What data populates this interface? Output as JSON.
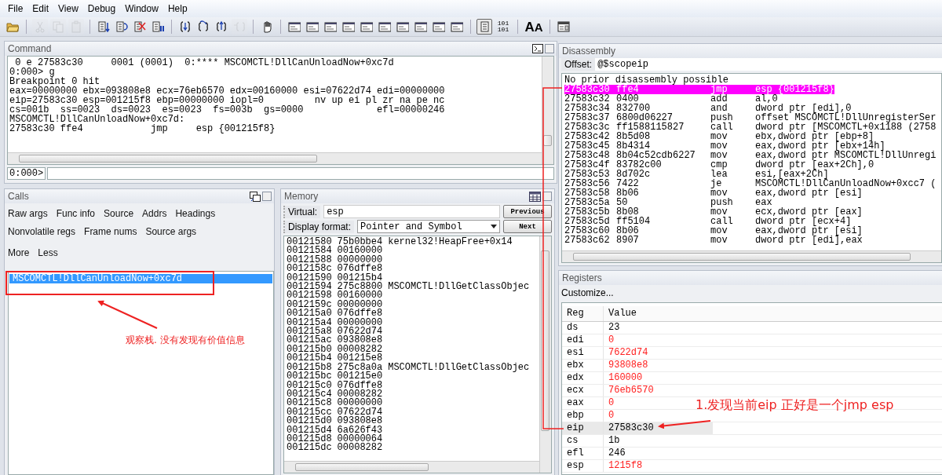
{
  "menu": [
    "File",
    "Edit",
    "View",
    "Debug",
    "Window",
    "Help"
  ],
  "toolbar": [
    {
      "kind": "open",
      "disabled": false
    },
    {
      "kind": "sep"
    },
    {
      "kind": "cut",
      "disabled": true
    },
    {
      "kind": "copy",
      "disabled": true
    },
    {
      "kind": "paste",
      "disabled": true
    },
    {
      "kind": "sep"
    },
    {
      "kind": "go",
      "disabled": false
    },
    {
      "kind": "restart",
      "disabled": false
    },
    {
      "kind": "stop",
      "disabled": false
    },
    {
      "kind": "break",
      "disabled": false
    },
    {
      "kind": "sep"
    },
    {
      "kind": "step-into",
      "disabled": false
    },
    {
      "kind": "step-over",
      "disabled": false
    },
    {
      "kind": "step-out",
      "disabled": false
    },
    {
      "kind": "run-to-cursor",
      "disabled": true
    },
    {
      "kind": "sep"
    },
    {
      "kind": "hand",
      "disabled": false
    },
    {
      "kind": "sep"
    },
    {
      "kind": "window",
      "disabled": false
    },
    {
      "kind": "window",
      "disabled": false
    },
    {
      "kind": "window",
      "disabled": false
    },
    {
      "kind": "window",
      "disabled": false
    },
    {
      "kind": "window",
      "disabled": false
    },
    {
      "kind": "window",
      "disabled": false
    },
    {
      "kind": "window",
      "disabled": false
    },
    {
      "kind": "window",
      "disabled": false
    },
    {
      "kind": "window",
      "disabled": false
    },
    {
      "kind": "window",
      "disabled": false
    },
    {
      "kind": "sep"
    },
    {
      "kind": "source-mode",
      "disabled": false,
      "selected": true
    },
    {
      "kind": "binary",
      "text": "101 101"
    },
    {
      "kind": "sep"
    },
    {
      "kind": "font",
      "text": "AA"
    },
    {
      "kind": "sep"
    },
    {
      "kind": "options",
      "disabled": false
    }
  ],
  "command": {
    "title": "Command",
    "lines": [
      " 0 e 27583c30     0001 (0001)  0:**** MSCOMCTL!DllCanUnloadNow+0xc7d",
      "0:000> g",
      "Breakpoint 0 hit",
      "eax=00000000 ebx=093808e8 ecx=76eb6570 edx=00160000 esi=07622d74 edi=00000000",
      "eip=27583c30 esp=001215f8 ebp=00000000 iopl=0         nv up ei pl zr na pe nc",
      "cs=001b  ss=0023  ds=0023  es=0023  fs=003b  gs=0000             efl=00000246",
      "MSCOMCTL!DllCanUnloadNow+0xc7d:",
      "27583c30 ffe4            jmp     esp {001215f8}"
    ],
    "prompt": "0:000>"
  },
  "calls": {
    "title": "Calls",
    "options": [
      [
        "Raw args",
        "Func info",
        "Source",
        "Addrs",
        "Headings"
      ],
      [
        "Nonvolatile regs",
        "Frame nums",
        "Source args"
      ],
      [
        "More",
        "Less"
      ]
    ],
    "frames": [
      {
        "text": "MSCOMCTL!DllCanUnloadNow+0xc7d",
        "selected": true
      }
    ]
  },
  "memory": {
    "title": "Memory",
    "virtual_label": "Virtual:",
    "virtual": "esp",
    "format_label": "Display format:",
    "format": "Pointer and Symbol",
    "buttons": [
      "Previous",
      "Next"
    ],
    "rows": [
      {
        "address": "00121580",
        "value": "75b0bbe4",
        "symbol": "kernel32!HeapFree+0x14"
      },
      {
        "address": "00121584",
        "value": "00160000"
      },
      {
        "address": "00121588",
        "value": "00000000"
      },
      {
        "address": "0012158c",
        "value": "076dffe8"
      },
      {
        "address": "00121590",
        "value": "001215b4"
      },
      {
        "address": "00121594",
        "value": "275c8800",
        "symbol": "MSCOMCTL!DllGetClassObjec"
      },
      {
        "address": "00121598",
        "value": "00160000"
      },
      {
        "address": "0012159c",
        "value": "00000000"
      },
      {
        "address": "001215a0",
        "value": "076dffe8"
      },
      {
        "address": "001215a4",
        "value": "00000000"
      },
      {
        "address": "001215a8",
        "value": "07622d74"
      },
      {
        "address": "001215ac",
        "value": "093808e8"
      },
      {
        "address": "001215b0",
        "value": "00008282"
      },
      {
        "address": "001215b4",
        "value": "001215e8"
      },
      {
        "address": "001215b8",
        "value": "275c8a0a",
        "symbol": "MSCOMCTL!DllGetClassObjec"
      },
      {
        "address": "001215bc",
        "value": "001215e0"
      },
      {
        "address": "001215c0",
        "value": "076dffe8"
      },
      {
        "address": "001215c4",
        "value": "00008282"
      },
      {
        "address": "001215c8",
        "value": "00000000"
      },
      {
        "address": "001215cc",
        "value": "07622d74"
      },
      {
        "address": "001215d0",
        "value": "093808e8"
      },
      {
        "address": "001215d4",
        "value": "6a626f43"
      },
      {
        "address": "001215d8",
        "value": "00000064"
      },
      {
        "address": "001215dc",
        "value": "00008282"
      }
    ]
  },
  "disassembly": {
    "title": "Disassembly",
    "offset_label": "Offset:",
    "offset": "@$scopeip",
    "header": "No prior disassembly possible",
    "rows": [
      {
        "address": "27583c30",
        "bytes": "ffe4",
        "mnemonic": "jmp",
        "operands": "esp {001215f8}",
        "selected": true
      },
      {
        "address": "27583c32",
        "bytes": "0400",
        "mnemonic": "add",
        "operands": "al,0",
        "selected": false
      },
      {
        "address": "27583c34",
        "bytes": "832700",
        "mnemonic": "and",
        "operands": "dword ptr [edi],0",
        "selected": false
      },
      {
        "address": "27583c37",
        "bytes": "6800d06227",
        "mnemonic": "push",
        "operands": "offset MSCOMCTL!DllUnregisterSer",
        "selected": false
      },
      {
        "address": "27583c3c",
        "bytes": "ff1588115827",
        "mnemonic": "call",
        "operands": "dword ptr [MSCOMCTL+0x1188 (2758",
        "selected": false
      },
      {
        "address": "27583c42",
        "bytes": "8b5d08",
        "mnemonic": "mov",
        "operands": "ebx,dword ptr [ebp+8]",
        "selected": false
      },
      {
        "address": "27583c45",
        "bytes": "8b4314",
        "mnemonic": "mov",
        "operands": "eax,dword ptr [ebx+14h]",
        "selected": false
      },
      {
        "address": "27583c48",
        "bytes": "8b04c52cdb6227",
        "mnemonic": "mov",
        "operands": "eax,dword ptr MSCOMCTL!DllUnregi",
        "selected": false
      },
      {
        "address": "27583c4f",
        "bytes": "83782c00",
        "mnemonic": "cmp",
        "operands": "dword ptr [eax+2Ch],0",
        "selected": false
      },
      {
        "address": "27583c53",
        "bytes": "8d702c",
        "mnemonic": "lea",
        "operands": "esi,[eax+2Ch]",
        "selected": false
      },
      {
        "address": "27583c56",
        "bytes": "7422",
        "mnemonic": "je",
        "operands": "MSCOMCTL!DllCanUnloadNow+0xcc7 (",
        "selected": false
      },
      {
        "address": "27583c58",
        "bytes": "8b06",
        "mnemonic": "mov",
        "operands": "eax,dword ptr [esi]",
        "selected": false
      },
      {
        "address": "27583c5a",
        "bytes": "50",
        "mnemonic": "push",
        "operands": "eax",
        "selected": false
      },
      {
        "address": "27583c5b",
        "bytes": "8b08",
        "mnemonic": "mov",
        "operands": "ecx,dword ptr [eax]",
        "selected": false
      },
      {
        "address": "27583c5d",
        "bytes": "ff5104",
        "mnemonic": "call",
        "operands": "dword ptr [ecx+4]",
        "selected": false
      },
      {
        "address": "27583c60",
        "bytes": "8b06",
        "mnemonic": "mov",
        "operands": "eax,dword ptr [esi]",
        "selected": false
      },
      {
        "address": "27583c62",
        "bytes": "8907",
        "mnemonic": "mov",
        "operands": "dword ptr [edi],eax",
        "selected": false
      }
    ]
  },
  "registers": {
    "title": "Registers",
    "customize": "Customize...",
    "columns": [
      "Reg",
      "Value"
    ],
    "rows": [
      {
        "reg": "ds",
        "value": "23",
        "changed": false,
        "selected": false
      },
      {
        "reg": "edi",
        "value": "0",
        "changed": true,
        "selected": false
      },
      {
        "reg": "esi",
        "value": "7622d74",
        "changed": true,
        "selected": false
      },
      {
        "reg": "ebx",
        "value": "93808e8",
        "changed": true,
        "selected": false
      },
      {
        "reg": "edx",
        "value": "160000",
        "changed": true,
        "selected": false
      },
      {
        "reg": "ecx",
        "value": "76eb6570",
        "changed": true,
        "selected": false
      },
      {
        "reg": "eax",
        "value": "0",
        "changed": true,
        "selected": false
      },
      {
        "reg": "ebp",
        "value": "0",
        "changed": true,
        "selected": false
      },
      {
        "reg": "eip",
        "value": "27583c30",
        "changed": false,
        "selected": true
      },
      {
        "reg": "cs",
        "value": "1b",
        "changed": false,
        "selected": false
      },
      {
        "reg": "efl",
        "value": "246",
        "changed": false,
        "selected": false
      },
      {
        "reg": "esp",
        "value": "1215f8",
        "changed": true,
        "selected": false
      }
    ]
  },
  "annotations": [
    {
      "text": "观察栈. 没有发现有价值信息"
    },
    {
      "text": "1.发现当前eip 正好是一个jmp esp"
    }
  ]
}
